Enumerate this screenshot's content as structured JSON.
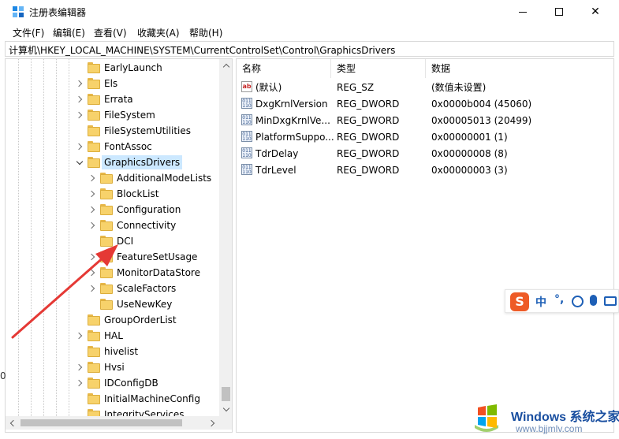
{
  "window": {
    "title": "注册表编辑器",
    "controls": {
      "minimize": "",
      "maximize": "",
      "close": "✕"
    }
  },
  "menubar": {
    "items": [
      "文件(F)",
      "编辑(E)",
      "查看(V)",
      "收藏夹(A)",
      "帮助(H)"
    ]
  },
  "address": {
    "path": "计算机\\HKEY_LOCAL_MACHINE\\SYSTEM\\CurrentControlSet\\Control\\GraphicsDrivers"
  },
  "tree": {
    "items": [
      {
        "label": "EarlyLaunch",
        "level": 1,
        "expandable": false,
        "expanded": false,
        "selected": false
      },
      {
        "label": "Els",
        "level": 1,
        "expandable": true,
        "expanded": false,
        "selected": false
      },
      {
        "label": "Errata",
        "level": 1,
        "expandable": true,
        "expanded": false,
        "selected": false
      },
      {
        "label": "FileSystem",
        "level": 1,
        "expandable": true,
        "expanded": false,
        "selected": false
      },
      {
        "label": "FileSystemUtilities",
        "level": 1,
        "expandable": false,
        "expanded": false,
        "selected": false
      },
      {
        "label": "FontAssoc",
        "level": 1,
        "expandable": true,
        "expanded": false,
        "selected": false
      },
      {
        "label": "GraphicsDrivers",
        "level": 1,
        "expandable": true,
        "expanded": true,
        "selected": true
      },
      {
        "label": "AdditionalModeLists",
        "level": 2,
        "expandable": true,
        "expanded": false,
        "selected": false
      },
      {
        "label": "BlockList",
        "level": 2,
        "expandable": true,
        "expanded": false,
        "selected": false
      },
      {
        "label": "Configuration",
        "level": 2,
        "expandable": true,
        "expanded": false,
        "selected": false
      },
      {
        "label": "Connectivity",
        "level": 2,
        "expandable": true,
        "expanded": false,
        "selected": false
      },
      {
        "label": "DCI",
        "level": 2,
        "expandable": false,
        "expanded": false,
        "selected": false
      },
      {
        "label": "FeatureSetUsage",
        "level": 2,
        "expandable": true,
        "expanded": false,
        "selected": false
      },
      {
        "label": "MonitorDataStore",
        "level": 2,
        "expandable": true,
        "expanded": false,
        "selected": false
      },
      {
        "label": "ScaleFactors",
        "level": 2,
        "expandable": true,
        "expanded": false,
        "selected": false
      },
      {
        "label": "UseNewKey",
        "level": 2,
        "expandable": false,
        "expanded": false,
        "selected": false
      },
      {
        "label": "GroupOrderList",
        "level": 1,
        "expandable": false,
        "expanded": false,
        "selected": false
      },
      {
        "label": "HAL",
        "level": 1,
        "expandable": true,
        "expanded": false,
        "selected": false
      },
      {
        "label": "hivelist",
        "level": 1,
        "expandable": false,
        "expanded": false,
        "selected": false
      },
      {
        "label": "Hvsi",
        "level": 1,
        "expandable": true,
        "expanded": false,
        "selected": false
      },
      {
        "label": "IDConfigDB",
        "level": 1,
        "expandable": true,
        "expanded": false,
        "selected": false
      },
      {
        "label": "InitialMachineConfig",
        "level": 1,
        "expandable": false,
        "expanded": false,
        "selected": false
      },
      {
        "label": "IntegrityServices",
        "level": 1,
        "expandable": false,
        "expanded": false,
        "selected": false
      }
    ]
  },
  "list": {
    "columns": [
      "名称",
      "类型",
      "数据"
    ],
    "rows": [
      {
        "icon": "string-value-icon",
        "name": "(默认)",
        "type": "REG_SZ",
        "data": "(数值未设置)"
      },
      {
        "icon": "binary-value-icon",
        "name": "DxgKrnlVersion",
        "type": "REG_DWORD",
        "data": "0x0000b004 (45060)"
      },
      {
        "icon": "binary-value-icon",
        "name": "MinDxgKrnlVe...",
        "type": "REG_DWORD",
        "data": "0x00005013 (20499)"
      },
      {
        "icon": "binary-value-icon",
        "name": "PlatformSuppo...",
        "type": "REG_DWORD",
        "data": "0x00000001 (1)"
      },
      {
        "icon": "binary-value-icon",
        "name": "TdrDelay",
        "type": "REG_DWORD",
        "data": "0x00000008 (8)"
      },
      {
        "icon": "binary-value-icon",
        "name": "TdrLevel",
        "type": "REG_DWORD",
        "data": "0x00000003 (3)"
      }
    ]
  },
  "ime": {
    "logo": "S",
    "mode": "中",
    "punct": "°,"
  },
  "watermark": {
    "line1": "Windows",
    "line1_suffix": "系统之家",
    "line2": "www.bjjmlv.com"
  },
  "colors": {
    "selection": "#cce8ff",
    "folder": "#f7d26b",
    "arrow": "#e53935"
  },
  "left_sliver": "0"
}
